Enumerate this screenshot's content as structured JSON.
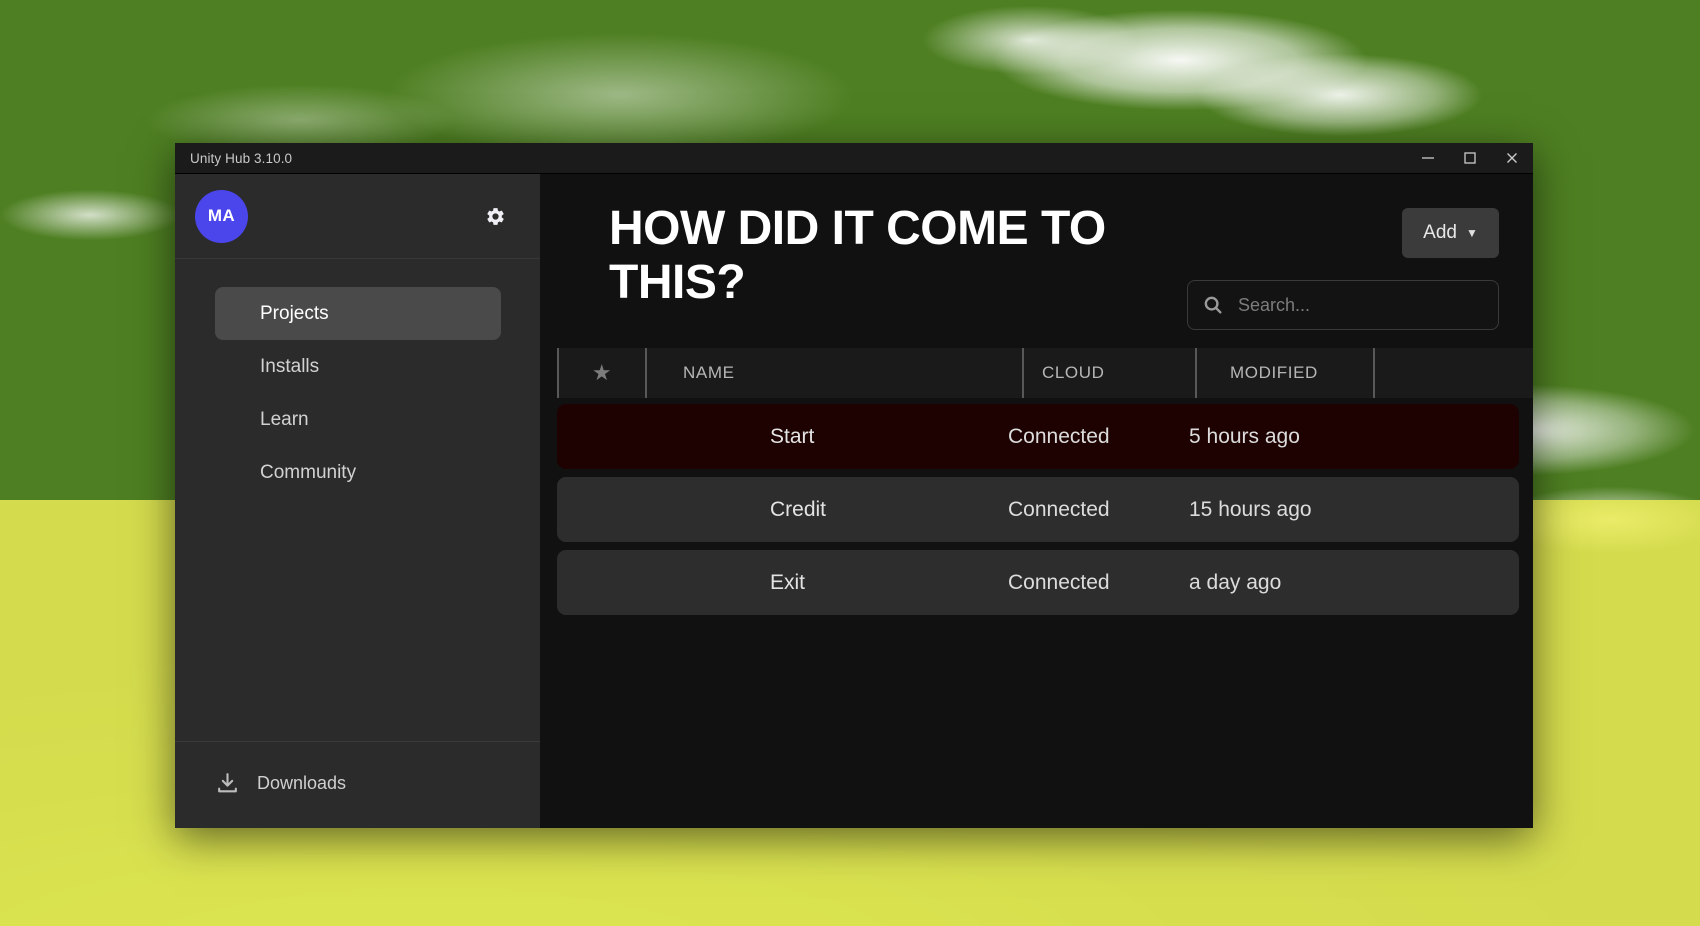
{
  "window": {
    "title": "Unity Hub 3.10.0",
    "controls": {
      "minimize": "minimize-icon",
      "maximize": "maximize-icon",
      "close": "close-icon"
    }
  },
  "sidebar": {
    "avatar_initials": "MA",
    "avatar_color": "#4b46ec",
    "settings_icon": "gear-icon",
    "items": [
      {
        "label": "Projects",
        "active": true
      },
      {
        "label": "Installs",
        "active": false
      },
      {
        "label": "Learn",
        "active": false
      },
      {
        "label": "Community",
        "active": false
      }
    ],
    "downloads": {
      "label": "Downloads",
      "icon": "download-icon"
    }
  },
  "main": {
    "page_title": "HOW DID IT COME TO THIS?",
    "add_button": {
      "label": "Add",
      "caret": "▼"
    },
    "search": {
      "placeholder": "Search...",
      "value": "",
      "icon": "search-icon"
    },
    "table": {
      "headers": {
        "star": "★",
        "name": "NAME",
        "cloud": "CLOUD",
        "modified": "MODIFIED",
        "extra": ""
      },
      "rows": [
        {
          "name": "Start",
          "cloud": "Connected",
          "modified": "5 hours ago",
          "highlight": true,
          "highlight_color": "#1e0202"
        },
        {
          "name": "Credit",
          "cloud": "Connected",
          "modified": "15 hours ago",
          "highlight": false,
          "highlight_color": "#2d2d2d"
        },
        {
          "name": "Exit",
          "cloud": "Connected",
          "modified": "a day ago",
          "highlight": false,
          "highlight_color": "#2d2d2d"
        }
      ]
    }
  }
}
